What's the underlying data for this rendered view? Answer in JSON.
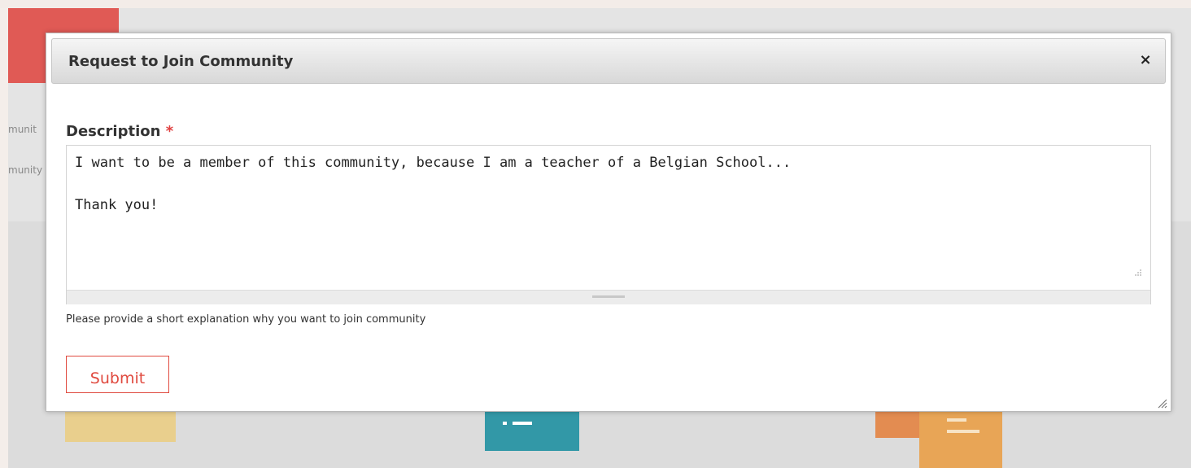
{
  "background": {
    "text_line_1": "munit",
    "text_line_2": "munity"
  },
  "modal": {
    "title": "Request to Join Community",
    "close_symbol": "×",
    "description_label": "Description",
    "required_marker": "*",
    "description_value": "I want to be a member of this community, because I am a teacher of a Belgian School...\n\nThank you!",
    "help_text": "Please provide a short explanation why you want to join community",
    "submit_label": "Submit"
  },
  "colors": {
    "accent": "#e04a3f",
    "required": "#e04040",
    "brand_red": "#e05a55"
  },
  "icons": {
    "close": "close-icon",
    "textarea_resize": "resize-grip-icon",
    "modal_resize": "resize-corner-icon"
  }
}
